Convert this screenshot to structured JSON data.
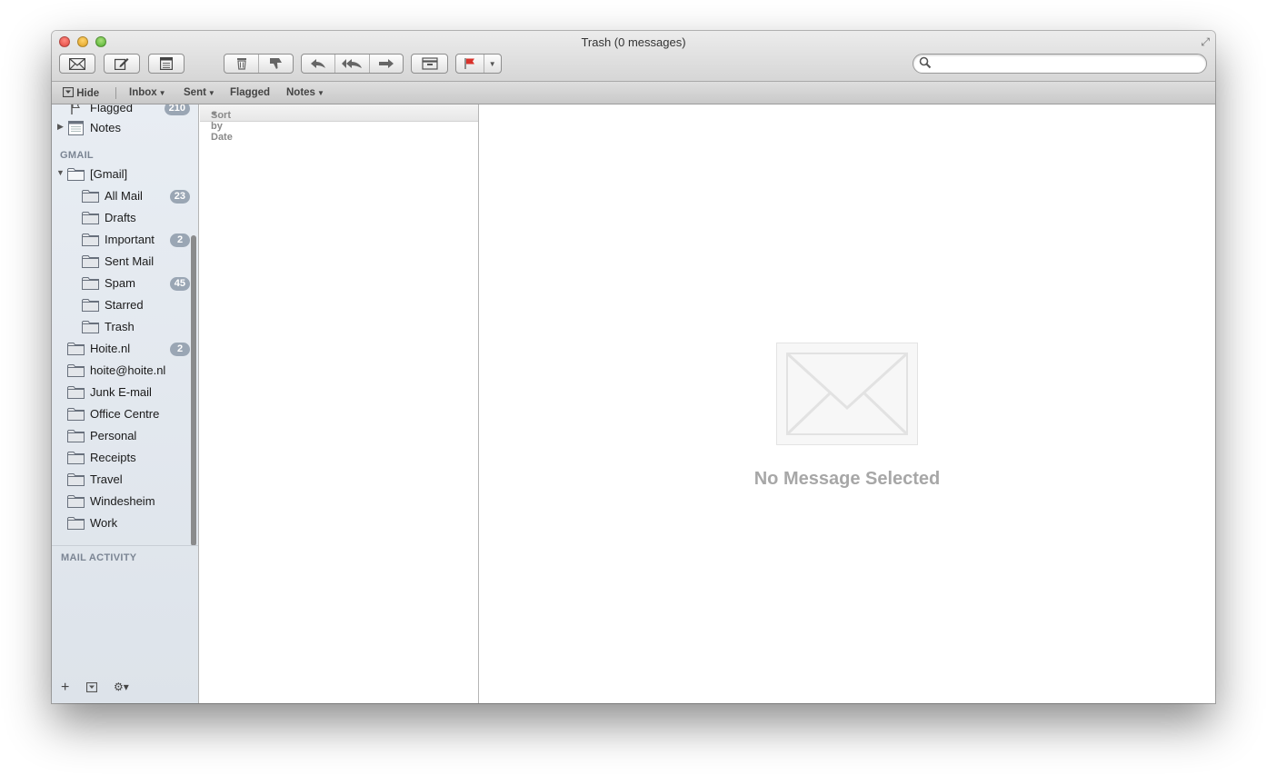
{
  "window": {
    "title": "Trash (0 messages)"
  },
  "toolbar": {
    "get_mail": "get-mail-icon",
    "compose": "compose-icon",
    "notes": "note-icon",
    "delete": "trash-icon",
    "junk": "thumbs-down-icon",
    "reply": "reply-icon",
    "reply_all": "reply-all-icon",
    "forward": "forward-icon",
    "archive": "archive-icon",
    "flag": "flag-icon",
    "search": {
      "placeholder": "",
      "value": ""
    }
  },
  "favorites": {
    "hide": "Hide",
    "items": [
      "Inbox",
      "Sent",
      "Flagged",
      "Notes"
    ]
  },
  "sidebar": {
    "top_items": [
      {
        "label": "Flagged",
        "badge": "210"
      },
      {
        "label": "Notes"
      }
    ],
    "gmail_header": "GMAIL",
    "gmail": {
      "label": "[Gmail]"
    },
    "gmail_children": [
      {
        "label": "All Mail",
        "badge": "23"
      },
      {
        "label": "Drafts"
      },
      {
        "label": "Important",
        "badge": "2"
      },
      {
        "label": "Sent Mail"
      },
      {
        "label": "Spam",
        "badge": "45"
      },
      {
        "label": "Starred"
      },
      {
        "label": "Trash"
      }
    ],
    "folders": [
      {
        "label": "Hoite.nl",
        "badge": "2"
      },
      {
        "label": "hoite@hoite.nl"
      },
      {
        "label": "Junk E-mail"
      },
      {
        "label": "Office Centre"
      },
      {
        "label": "Personal"
      },
      {
        "label": "Receipts"
      },
      {
        "label": "Travel"
      },
      {
        "label": "Windesheim"
      },
      {
        "label": "Work"
      }
    ],
    "activity_header": "MAIL ACTIVITY",
    "bottom": {
      "add": "+",
      "gear": "⚙▾"
    }
  },
  "message_list": {
    "sort_label": "Sort by Date"
  },
  "viewer": {
    "empty_text": "No Message Selected"
  },
  "colors": {
    "badge": "#9aa6b4",
    "sidebar_bg": "#e8edf3",
    "flag_red": "#d9322b"
  }
}
